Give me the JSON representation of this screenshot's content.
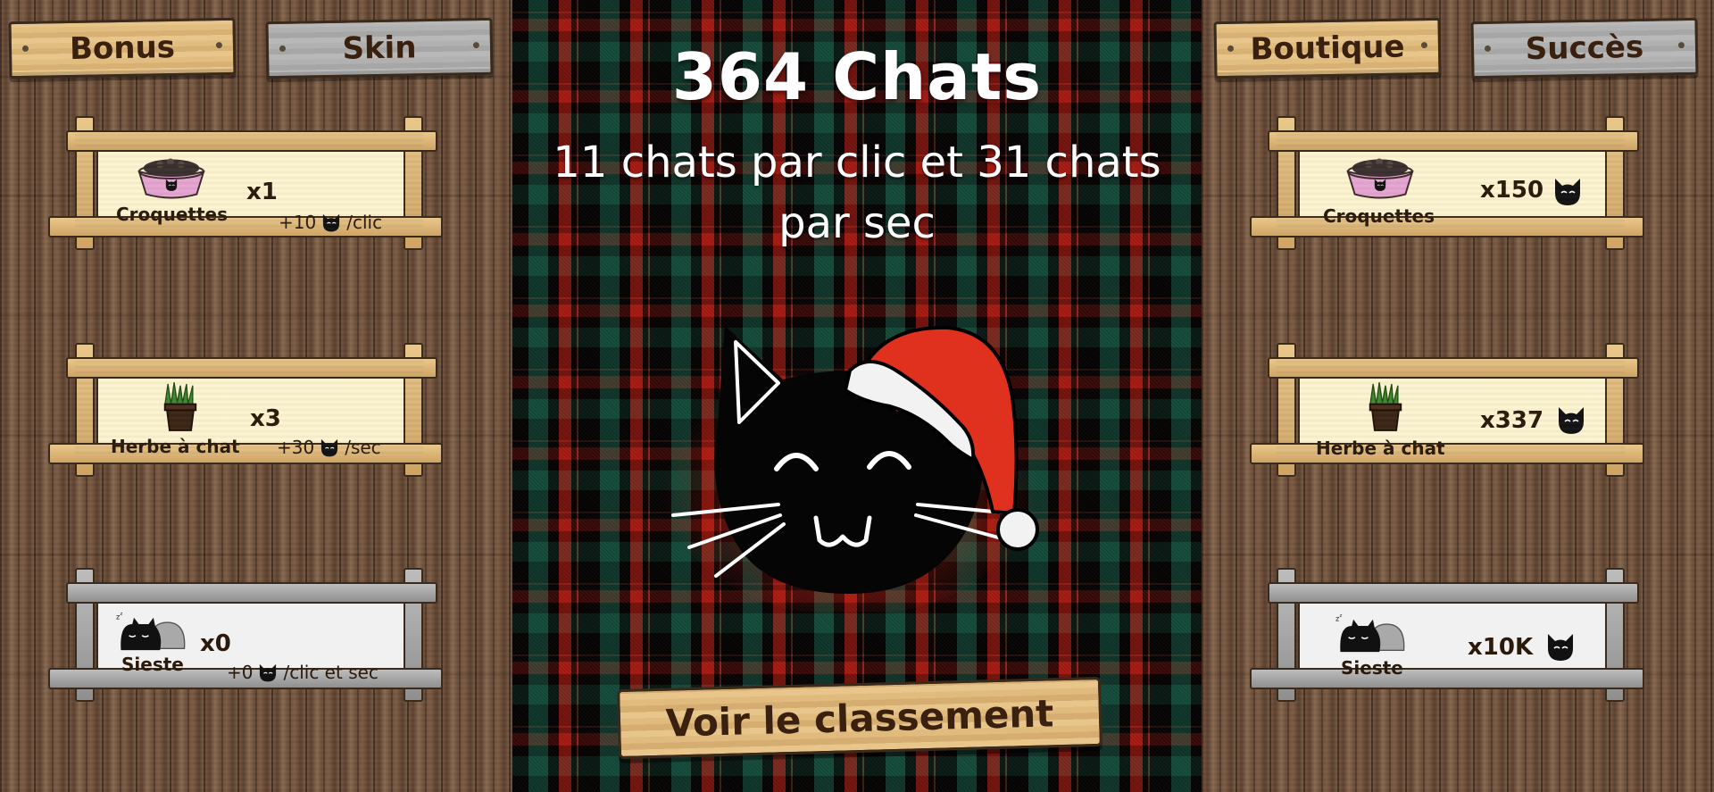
{
  "tabs": {
    "bonus": "Bonus",
    "skin": "Skin",
    "shop": "Boutique",
    "achievements": "Succès"
  },
  "score": {
    "title": "364 Chats",
    "rate": "11 chats par clic et 31 chats par sec"
  },
  "ranking_button": "Voir le classement",
  "bonuses": [
    {
      "name": "Croquettes",
      "qty": "x1",
      "effect_value": "+10",
      "effect_unit": "/clic",
      "icon": "cat-food-bowl-icon",
      "style": "wood"
    },
    {
      "name": "Herbe à chat",
      "qty": "x3",
      "effect_value": "+30",
      "effect_unit": "/sec",
      "icon": "cat-grass-pot-icon",
      "style": "wood"
    },
    {
      "name": "Sieste",
      "qty": "x0",
      "effect_value": "+0",
      "effect_unit": "/clic et sec",
      "icon": "sleeping-cats-icon",
      "style": "stone"
    }
  ],
  "shop": [
    {
      "name": "Croquettes",
      "price": "x150",
      "icon": "cat-food-bowl-icon",
      "style": "wood"
    },
    {
      "name": "Herbe à chat",
      "price": "x337",
      "icon": "cat-grass-pot-icon",
      "style": "wood"
    },
    {
      "name": "Sieste",
      "price": "x10K",
      "icon": "sleeping-cats-icon",
      "style": "stone"
    }
  ],
  "colors": {
    "sign_text": "#3a200f",
    "hat_red": "#e0301e",
    "tartan_green": "#145a46",
    "tartan_red": "#c81e14"
  }
}
